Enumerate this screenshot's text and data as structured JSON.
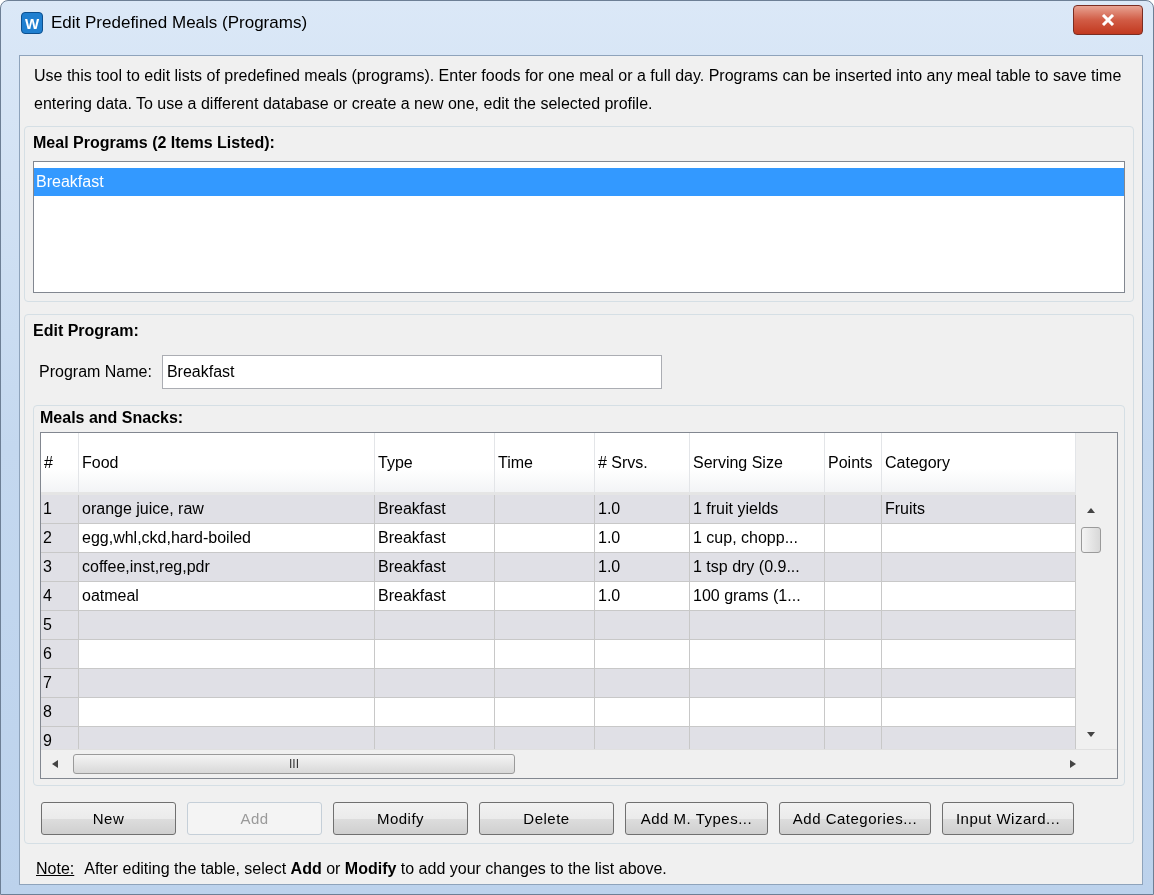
{
  "window": {
    "app_icon_letter": "W",
    "title": "Edit Predefined Meals (Programs)"
  },
  "description": "Use this tool to edit lists of predefined meals (programs).  Enter foods for one meal or a full day.  Programs can be inserted into any meal table to save time entering data.  To use a different database or create a new one, edit the selected profile.",
  "meal_programs": {
    "label": "Meal Programs (2 Items Listed):",
    "items": [
      {
        "label": "Breakfast",
        "selected": true
      }
    ]
  },
  "edit_program": {
    "label": "Edit Program:",
    "program_name_label": "Program Name:",
    "program_name": "Breakfast"
  },
  "meals_table": {
    "label": "Meals and Snacks:",
    "columns": [
      "#",
      "Food",
      "Type",
      "Time",
      "# Srvs.",
      "Serving Size",
      "Points",
      "Category"
    ],
    "rows": [
      {
        "num": "1",
        "food": "orange juice, raw",
        "type": "Breakfast",
        "servings": "1.0",
        "serving_size": "1 fruit yields",
        "category": "Fruits"
      },
      {
        "num": "2",
        "food": "egg,whl,ckd,hard-boiled",
        "type": "Breakfast",
        "servings": "1.0",
        "serving_size": "1 cup, chopp..."
      },
      {
        "num": "3",
        "food": "coffee,inst,reg,pdr",
        "type": "Breakfast",
        "servings": "1.0",
        "serving_size": "1 tsp dry (0.9..."
      },
      {
        "num": "4",
        "food": "oatmeal",
        "type": "Breakfast",
        "servings": "1.0",
        "serving_size": "100 grams (1..."
      },
      {
        "num": "5"
      },
      {
        "num": "6"
      },
      {
        "num": "7"
      },
      {
        "num": "8"
      },
      {
        "num": "9"
      }
    ],
    "scrollbar_grip": "III"
  },
  "buttons": [
    {
      "label": "New",
      "disabled": false
    },
    {
      "label": "Add",
      "disabled": true
    },
    {
      "label": "Modify",
      "disabled": false
    },
    {
      "label": "Delete",
      "disabled": false
    },
    {
      "label": "Add M. Types...",
      "disabled": false
    },
    {
      "label": "Add Categories...",
      "disabled": false
    },
    {
      "label": "Input Wizard...",
      "disabled": false
    }
  ],
  "note": {
    "label": "Note:",
    "text": "After editing the table, select **Add** or **Modify** to add your changes to the list above."
  }
}
